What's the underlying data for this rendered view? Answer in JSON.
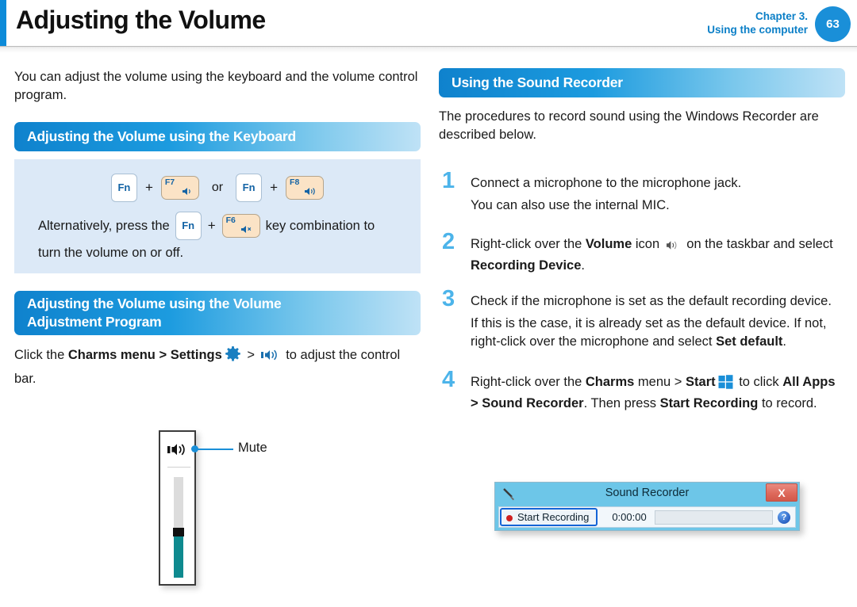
{
  "header": {
    "title": "Adjusting the Volume",
    "chapter_line1": "Chapter 3.",
    "chapter_line2": "Using the computer",
    "page_number": "63",
    "accent_color": "#0d8bd9"
  },
  "left": {
    "intro": "You can adjust the volume using the keyboard and the volume control program.",
    "section1_title": "Adjusting the Volume using the Keyboard",
    "keys": {
      "fn": "Fn",
      "plus": "+",
      "or": "or",
      "f7_label": "F7",
      "f7_icon": "volume-down-icon",
      "f8_label": "F8",
      "f8_icon": "volume-up-icon",
      "f6_label": "F6",
      "f6_icon": "volume-mute-icon"
    },
    "alt_text_before": "Alternatively, press the",
    "alt_text_middle": "key combination to",
    "alt_text_after": "turn the volume on or off.",
    "section2_title_line1": "Adjusting the Volume using the Volume",
    "section2_title_line2": "Adjustment Program",
    "charms": {
      "part1": "Click the ",
      "bold1": "Charms menu > Settings",
      "gear": "gear-icon",
      "sep": " > ",
      "speaker": "speaker-icon",
      "part2": " to adjust the control bar."
    },
    "figure": {
      "callout_label": "Mute",
      "speaker_icon": "speaker-icon",
      "fill_color": "#0e8a8f"
    }
  },
  "right": {
    "section_title": "Using the Sound Recorder",
    "intro": "The procedures to record sound using the Windows Recorder are described below.",
    "steps": [
      {
        "number": "1",
        "text": "Connect a microphone to the microphone jack.",
        "subtext": "You can also use the internal MIC."
      },
      {
        "number": "2",
        "text_a": "Right-click over the ",
        "bold_a": "Volume",
        "text_b": " icon ",
        "icon": "speaker-icon",
        "text_c": " on the taskbar and select ",
        "bold_b": "Recording Device",
        "text_d": "."
      },
      {
        "number": "3",
        "text": "Check if the microphone is set as the default recording device.",
        "subtext_a": "If this is the case, it is already set as the default device. If not, right-click over the microphone and select ",
        "subtext_bold": "Set default",
        "subtext_b": "."
      },
      {
        "number": "4",
        "text_a": "Right-click over the ",
        "bold_a": "Charms",
        "text_b": " menu > ",
        "bold_b": "Start",
        "icon": "windows-logo-icon",
        "text_c": " to click ",
        "bold_c": "All Apps > Sound Recorder",
        "text_d": ". Then press ",
        "bold_d": "Start Recording",
        "text_e": " to record."
      }
    ],
    "sound_recorder": {
      "title": "Sound Recorder",
      "mic_icon": "microphone-icon",
      "close_label": "X",
      "record_button_label": "Start Recording",
      "record_button_underline": "S",
      "time": "0:00:00",
      "help_label": "?",
      "titlebar_color": "#6dc6e8",
      "close_color": "#de6a5c"
    }
  }
}
